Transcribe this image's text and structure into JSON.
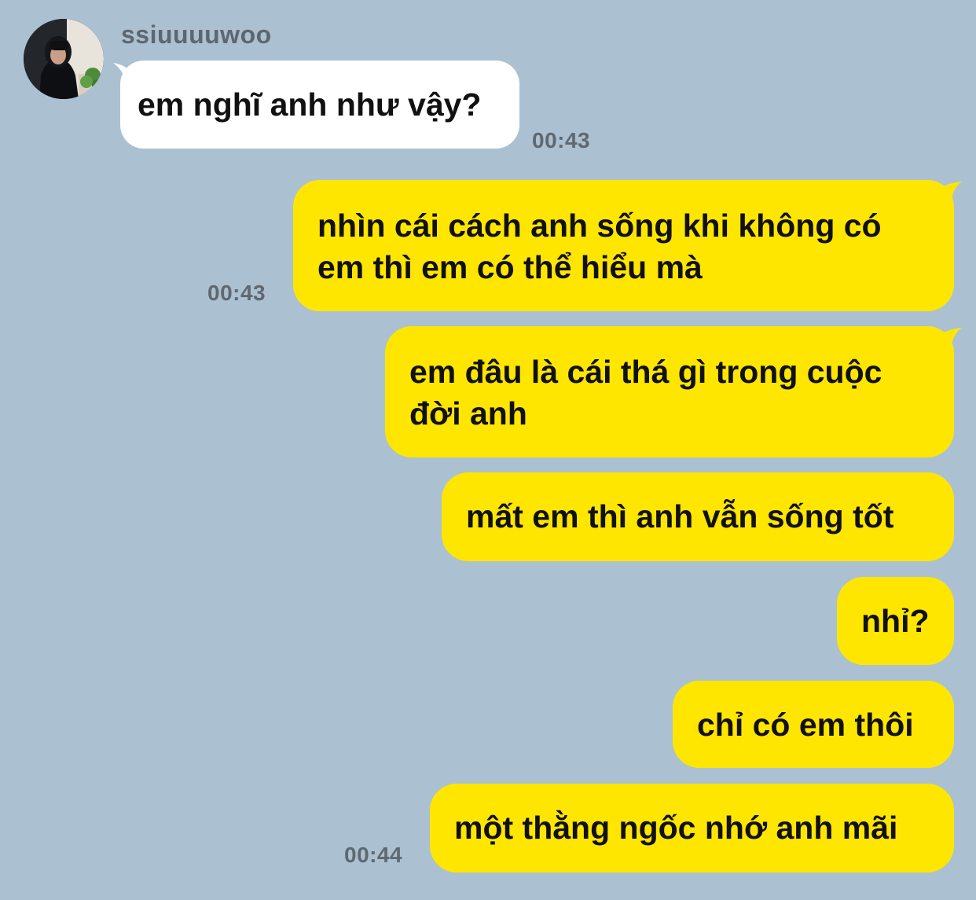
{
  "chat": {
    "sender": {
      "name": "ssiuuuuwoo"
    },
    "messages": [
      {
        "text": "em nghĩ anh như vậy?",
        "time": "00:43",
        "direction": "incoming"
      },
      {
        "text_lines": [
          "nhìn cái cách anh sống khi không có",
          "em thì em có thể hiểu mà"
        ],
        "time": "00:43",
        "direction": "outgoing"
      },
      {
        "text_lines": [
          "em đâu là cái thá gì trong cuộc",
          "đời anh"
        ],
        "direction": "outgoing"
      },
      {
        "text": "mất em thì anh vẫn sống tốt",
        "direction": "outgoing"
      },
      {
        "text": "nhỉ?",
        "direction": "outgoing"
      },
      {
        "text": "chỉ có em thôi",
        "direction": "outgoing"
      },
      {
        "text": "một thằng ngốc nhớ anh mãi",
        "time": "00:44",
        "direction": "outgoing"
      }
    ]
  },
  "colors": {
    "background": "#abc1d1",
    "outgoing_bubble": "#ffe600",
    "incoming_bubble": "#ffffff",
    "timestamp": "#5f6870"
  },
  "icons": {
    "avatar": "profile-photo"
  }
}
